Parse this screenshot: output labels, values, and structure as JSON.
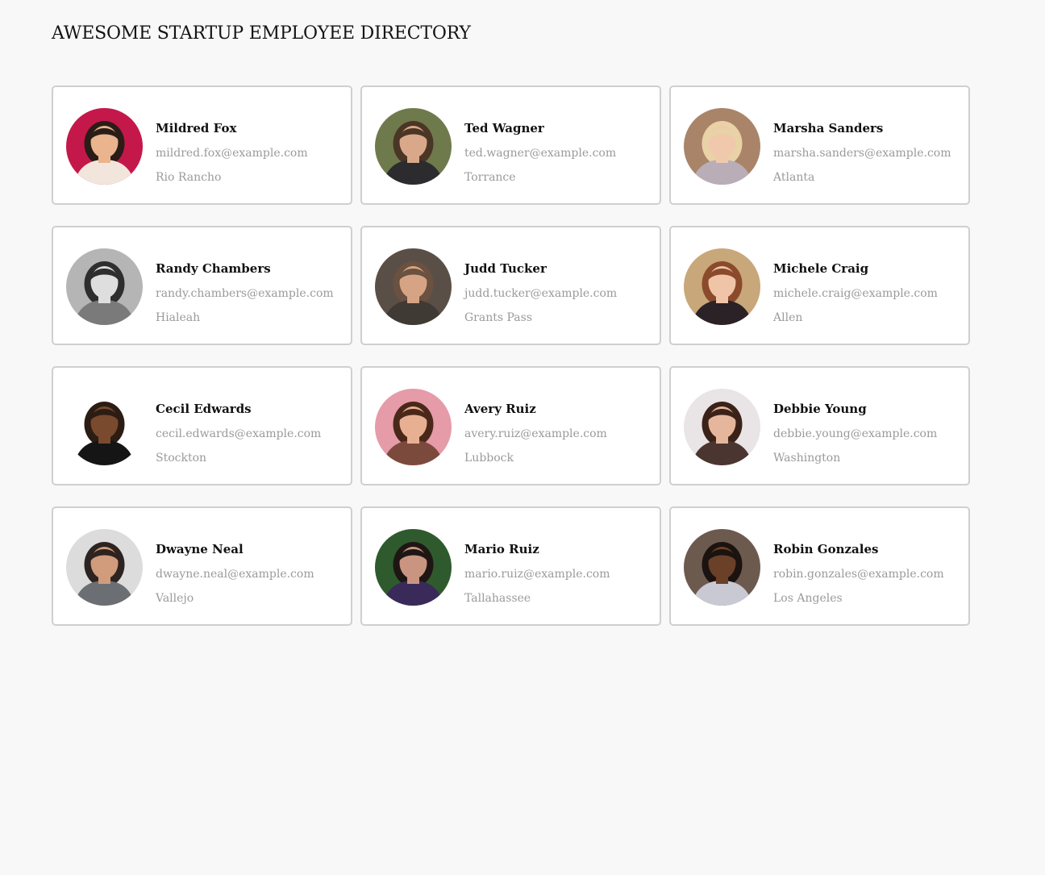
{
  "header": {
    "title": "AWESOME STARTUP EMPLOYEE DIRECTORY"
  },
  "employees": [
    {
      "name": "Mildred Fox",
      "email": "mildred.fox@example.com",
      "city": "Rio Rancho",
      "avatar_icon": "avatar-photo-icon",
      "bg": "#c4184a",
      "skin": "#e9b48e",
      "hair": "#2a1d17",
      "shirt": "#f2e6dc"
    },
    {
      "name": "Ted Wagner",
      "email": "ted.wagner@example.com",
      "city": "Torrance",
      "avatar_icon": "avatar-photo-icon",
      "bg": "#6f7a4c",
      "skin": "#d9a88a",
      "hair": "#4b3626",
      "shirt": "#2c2c2e"
    },
    {
      "name": "Marsha Sanders",
      "email": "marsha.sanders@example.com",
      "city": "Atlanta",
      "avatar_icon": "avatar-photo-icon",
      "bg": "#a98468",
      "skin": "#f0c9ad",
      "hair": "#e8d2a6",
      "shirt": "#b9aeb8"
    },
    {
      "name": "Randy Chambers",
      "email": "randy.chambers@example.com",
      "city": "Hialeah",
      "avatar_icon": "avatar-photo-icon",
      "bg": "#b5b5b5",
      "skin": "#dedede",
      "hair": "#2e2e2e",
      "shirt": "#7a7a7a"
    },
    {
      "name": "Judd Tucker",
      "email": "judd.tucker@example.com",
      "city": "Grants Pass",
      "avatar_icon": "avatar-photo-icon",
      "bg": "#5a4f46",
      "skin": "#d6a485",
      "hair": "#6a5140",
      "shirt": "#3f3a34"
    },
    {
      "name": "Michele Craig",
      "email": "michele.craig@example.com",
      "city": "Allen",
      "avatar_icon": "avatar-photo-icon",
      "bg": "#c8a77a",
      "skin": "#f0c4a7",
      "hair": "#8b4a2c",
      "shirt": "#2b2228"
    },
    {
      "name": "Cecil Edwards",
      "email": "cecil.edwards@example.com",
      "city": "Stockton",
      "avatar_icon": "avatar-photo-icon",
      "bg": "#ffffff",
      "skin": "#7a4a2e",
      "hair": "#2b1d14",
      "shirt": "#151515"
    },
    {
      "name": "Avery Ruiz",
      "email": "avery.ruiz@example.com",
      "city": "Lubbock",
      "avatar_icon": "avatar-photo-icon",
      "bg": "#e59ba8",
      "skin": "#e8b092",
      "hair": "#4a2819",
      "shirt": "#7b4a3c"
    },
    {
      "name": "Debbie Young",
      "email": "debbie.young@example.com",
      "city": "Washington",
      "avatar_icon": "avatar-photo-icon",
      "bg": "#e9e4e6",
      "skin": "#e6b69c",
      "hair": "#3b2219",
      "shirt": "#4a3530"
    },
    {
      "name": "Dwayne Neal",
      "email": "dwayne.neal@example.com",
      "city": "Vallejo",
      "avatar_icon": "avatar-photo-icon",
      "bg": "#dcdcdc",
      "skin": "#d09c7c",
      "hair": "#2d2320",
      "shirt": "#6b6e72"
    },
    {
      "name": "Mario Ruiz",
      "email": "mario.ruiz@example.com",
      "city": "Tallahassee",
      "avatar_icon": "avatar-photo-icon",
      "bg": "#2f5a2e",
      "skin": "#c99580",
      "hair": "#1e1614",
      "shirt": "#3a2a5a"
    },
    {
      "name": "Robin Gonzales",
      "email": "robin.gonzales@example.com",
      "city": "Los Angeles",
      "avatar_icon": "avatar-photo-icon",
      "bg": "#6d5a4f",
      "skin": "#6b4029",
      "hair": "#1b1310",
      "shirt": "#c9c9d4"
    }
  ]
}
